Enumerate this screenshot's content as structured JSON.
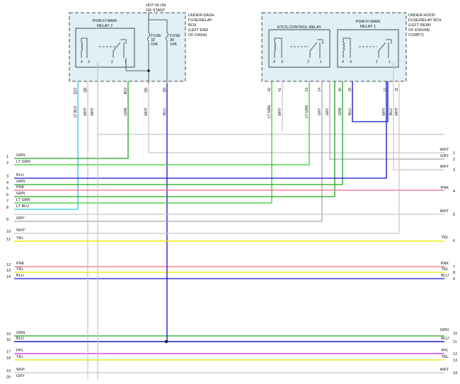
{
  "colors": {
    "GRN": "#1ea81e",
    "LT GRN": "#2fcf2f",
    "BLU": "#1010c8",
    "PNK": "#f06a8a",
    "WHT": "#c8c8c8",
    "YEL": "#e8e800",
    "GRY": "#a8a8a8",
    "LT BLU": "#22c8e8",
    "PPL": "#d020d0",
    "box_fill": "#dff0f6",
    "box_stroke": "#4a4a4a"
  },
  "boxes": {
    "left": {
      "relay_label_1": "PGM-FI MAIN",
      "relay_label_2": "RELAY 2",
      "hot_label_1": "HOT IN ON",
      "hot_label_2": "OR START",
      "fuse_a_1": "FUSE",
      "fuse_a_2": "32",
      "fuse_a_3": "15A",
      "fuse_b_1": "FUSE",
      "fuse_b_2": "30",
      "fuse_b_3": "10A",
      "desc": [
        "UNDER-DASH",
        "FUSE/RELAY",
        "BOX",
        "(LEFT END",
        "OF DASH)"
      ],
      "pins": [
        "4",
        "3",
        "2",
        "1"
      ]
    },
    "right": {
      "etcs_label": "ETCS CONTROL RELAY",
      "relay1_label_1": "PGM-FI MAIN",
      "relay1_label_2": "RELAY 1",
      "desc": [
        "UNDER-HOOD",
        "FUSE/RELAY BOX",
        "(LEFT REAR",
        "OF ENGINE",
        "COMPT)"
      ],
      "etcs_pins": [
        "4",
        "3",
        "2",
        "1"
      ],
      "relay1_pins": [
        "4",
        "3",
        "2",
        "1"
      ]
    }
  },
  "terminals": [
    "Q12",
    "Q8",
    "N19",
    "Q5",
    "Q9",
    "42",
    "41",
    "13",
    "14",
    "40",
    "39",
    "12",
    "11"
  ],
  "drops": [
    {
      "wire": "LT BLU",
      "label": "LT BLU"
    },
    {
      "wire": "WHT",
      "label": "WHT"
    },
    {
      "wire": "WHT",
      "label": "WHT"
    },
    {
      "wire": "GRN",
      "label": "GRN"
    },
    {
      "wire": "WHT",
      "label": "WHT"
    },
    {
      "wire": "BLU",
      "label": "BLU"
    },
    {
      "wire": "LT GRN",
      "label": "LT GRN"
    },
    {
      "wire": "WHT",
      "label": "WHT"
    },
    {
      "wire": "LT GRN",
      "label": "LT GRN"
    },
    {
      "wire": "GRY",
      "label": "GRY"
    },
    {
      "wire": "GRY",
      "label": "GRY"
    },
    {
      "wire": "GRN",
      "label": "GRN"
    },
    {
      "wire": "BLU",
      "label": "BLU"
    },
    {
      "wire": "WHT",
      "label": "WHT"
    },
    {
      "wire": "BLU",
      "label": "BLU"
    },
    {
      "wire": "WHT",
      "label": "WHT"
    }
  ],
  "left_rows": [
    {
      "num": "1",
      "label": "GRN",
      "wire": "GRN"
    },
    {
      "num": "2",
      "label": "LT GRN",
      "wire": "LT GRN"
    },
    {
      "num": "3",
      "label": "BLU",
      "wire": "BLU"
    },
    {
      "num": "4",
      "label": "GRN",
      "wire": "GRN"
    },
    {
      "num": "5",
      "label": "PNK",
      "wire": "PNK"
    },
    {
      "num": "6",
      "label": "GRN",
      "wire": "GRN"
    },
    {
      "num": "7",
      "label": "LT GRN",
      "wire": "LT GRN"
    },
    {
      "num": "8",
      "label": "LT BLU",
      "wire": "LT BLU"
    },
    {
      "num": "9",
      "label": "GRY",
      "wire": "GRY"
    },
    {
      "num": "10",
      "label": "WHT",
      "wire": "WHT"
    },
    {
      "num": "11",
      "label": "YEL",
      "wire": "YEL"
    },
    {
      "num": "12",
      "label": "PNK",
      "wire": "PNK"
    },
    {
      "num": "13",
      "label": "YEL",
      "wire": "YEL"
    },
    {
      "num": "14",
      "label": "BLU",
      "wire": "BLU"
    },
    {
      "num": "15",
      "label": "GRN",
      "wire": "GRN"
    },
    {
      "num": "16",
      "label": "BLU",
      "wire": "BLU"
    },
    {
      "num": "17",
      "label": "PPL",
      "wire": "PPL"
    },
    {
      "num": "18",
      "label": "YEL",
      "wire": "YEL"
    },
    {
      "num": "19",
      "label": "WHT",
      "wire": "WHT"
    },
    {
      "num": "20",
      "label": "GRY",
      "wire": "GRY"
    }
  ],
  "right_rows": [
    {
      "num": "1",
      "label": "WHT",
      "wire": "WHT"
    },
    {
      "num": "2",
      "label": "GRY",
      "wire": "GRY"
    },
    {
      "num": "3",
      "label": "WHT",
      "wire": "WHT"
    },
    {
      "num": "4",
      "label": "PNK",
      "wire": "PNK"
    },
    {
      "num": "5",
      "label": "WHT",
      "wire": "WHT"
    },
    {
      "num": "6",
      "label": "YEL",
      "wire": "YEL"
    },
    {
      "num": "7",
      "label": "PNK",
      "wire": "PNK"
    },
    {
      "num": "8",
      "label": "YEL",
      "wire": "YEL"
    },
    {
      "num": "9",
      "label": "BLU",
      "wire": "BLU"
    },
    {
      "num": "10",
      "label": "GRN",
      "wire": "GRN"
    },
    {
      "num": "11",
      "label": "BLU",
      "wire": "BLU"
    },
    {
      "num": "12",
      "label": "PPL",
      "wire": "PPL"
    },
    {
      "num": "13",
      "label": "YEL",
      "wire": "YEL"
    },
    {
      "num": "14",
      "label": "WHT",
      "wire": "WHT"
    }
  ]
}
